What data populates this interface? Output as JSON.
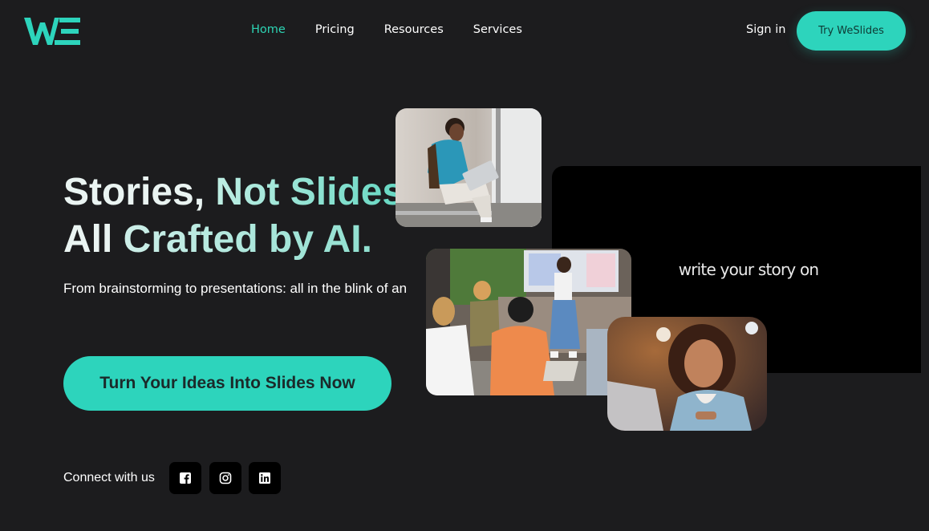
{
  "brand": {
    "logo_text": "WE",
    "accent": "#2dd4bc"
  },
  "nav": {
    "items": [
      {
        "label": "Home",
        "active": true
      },
      {
        "label": "Pricing",
        "active": false
      },
      {
        "label": "Resources",
        "active": false
      },
      {
        "label": "Services",
        "active": false
      }
    ],
    "signin_label": "Sign in",
    "try_label": "Try WeSlides"
  },
  "hero": {
    "line1_a": "Stories, ",
    "line1_b": "Not Slides.",
    "line2_a": "All ",
    "line2_b": "Crafted by AI.",
    "subtext": "From brainstorming to presentations: all in the blink of an",
    "cta_label": "Turn Your Ideas Into Slides Now",
    "video_text": "write your story on"
  },
  "footer": {
    "connect_label": "Connect with us",
    "socials": [
      "facebook-icon",
      "instagram-icon",
      "linkedin-icon"
    ]
  }
}
